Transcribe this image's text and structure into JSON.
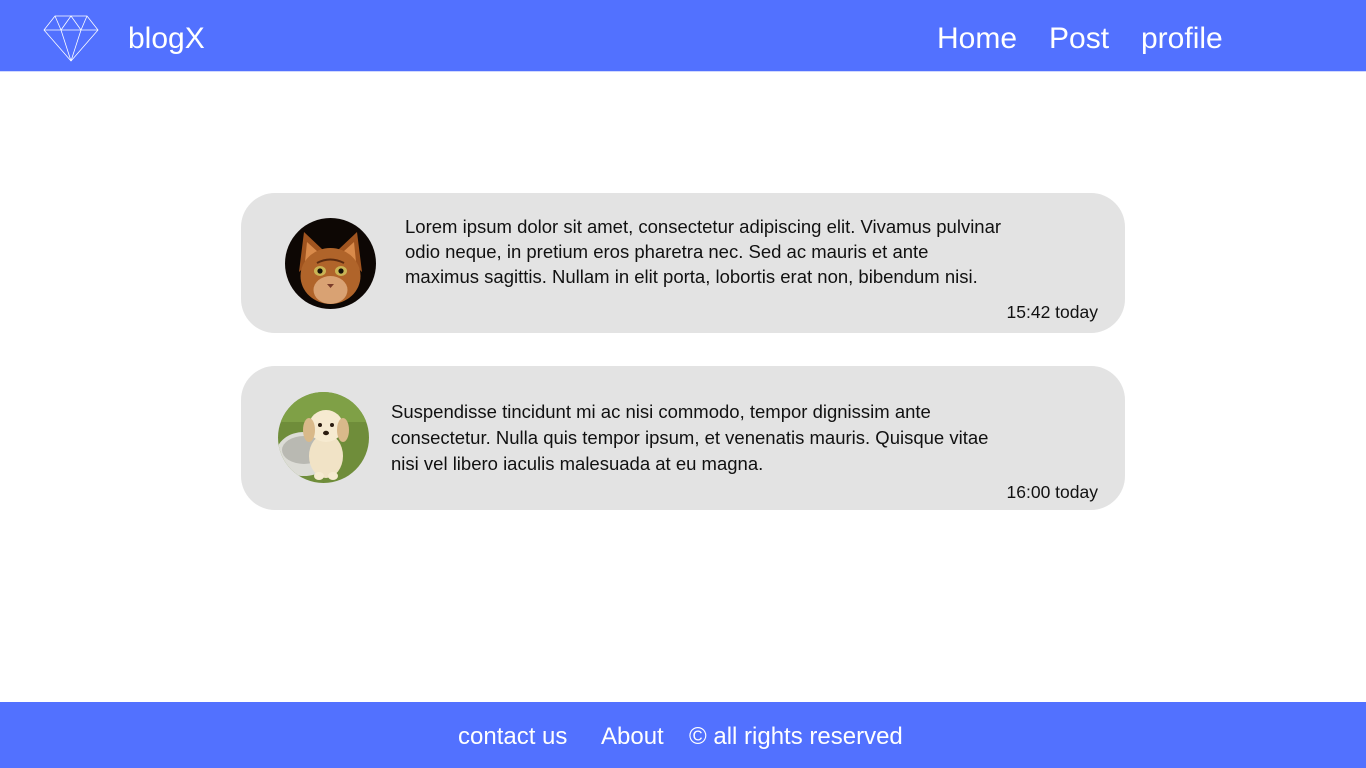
{
  "header": {
    "logo_icon": "diamond-icon",
    "brand": "blogX",
    "nav": {
      "home": "Home",
      "post": "Post",
      "profile": "profile"
    }
  },
  "posts": [
    {
      "avatar": "kitten-avatar",
      "text": "Lorem ipsum dolor sit amet, consectetur adipiscing elit. Vivamus pulvinar odio neque, in pretium eros pharetra nec. Sed ac mauris et ante maximus sagittis. Nullam in elit porta, lobortis erat non, bibendum nisi.",
      "time": "15:42 today"
    },
    {
      "avatar": "puppy-avatar",
      "text": "Suspendisse tincidunt mi ac nisi commodo, tempor dignissim ante consectetur. Nulla quis tempor ipsum, et venenatis mauris. Quisque vitae nisi vel libero iaculis malesuada at eu magna.",
      "time": "16:00 today"
    }
  ],
  "footer": {
    "contact": "contact us",
    "about": "About",
    "rights": "© all rights reserved"
  },
  "colors": {
    "accent": "#5271FF",
    "card": "#E3E3E3",
    "text": "#111111"
  }
}
